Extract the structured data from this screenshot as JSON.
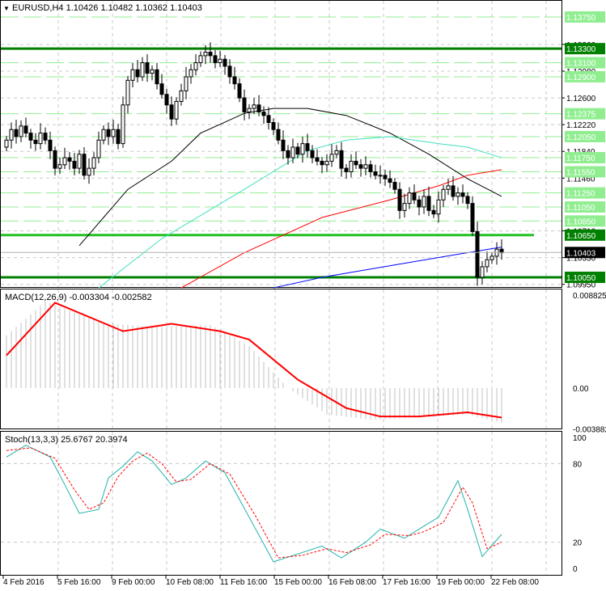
{
  "header": {
    "symbol": "EURUSD,H4",
    "ohlc": "1.10426 1.10482 1.10362 1.10403"
  },
  "macd_label": "MACD(12,26,9) -0.003304 -0.002582",
  "stoch_label": "Stoch(13,3,3) 25.6767 20.3974",
  "colors": {
    "up": "#ffffff",
    "down": "#000000",
    "level": "#008000",
    "level_light": "#90ee90",
    "ma_fast": "#000000",
    "ma_mid": "#40e0c0",
    "ma_slow": "#ff0000",
    "ma_long": "#0000ff",
    "macd": "#ff0000",
    "stoch_main": "#20b2aa",
    "stoch_signal": "#ff0000"
  },
  "chart_data": {
    "type": "candlestick",
    "symbol": "EURUSD",
    "timeframe": "H4",
    "price_range": [
      1.099,
      1.14
    ],
    "x_labels": [
      "4 Feb 2016",
      "5 Feb 16:00",
      "9 Feb 00:00",
      "10 Feb 08:00",
      "11 Feb 16:00",
      "15 Feb 00:00",
      "16 Feb 08:00",
      "17 Feb 16:00",
      "19 Feb 00:00",
      "22 Feb 08:00"
    ],
    "price_grid": [
      "1.13360",
      "1.12980",
      "1.12600",
      "1.12220",
      "1.11840",
      "1.11460",
      "1.10710",
      "1.10330",
      "1.09950"
    ],
    "levels_strong": [
      "1.13300",
      "1.10650",
      "1.10050"
    ],
    "levels_light": [
      "1.13750",
      "1.13100",
      "1.12900",
      "1.12375",
      "1.12050",
      "1.11750",
      "1.11550",
      "1.11250",
      "1.11050",
      "1.10850"
    ],
    "current_price": "1.10403",
    "closes": [
      1.12,
      1.1215,
      1.1205,
      1.122,
      1.121,
      1.12,
      1.1195,
      1.121,
      1.12,
      1.1185,
      1.116,
      1.1165,
      1.1175,
      1.117,
      1.116,
      1.118,
      1.115,
      1.116,
      1.1175,
      1.12,
      1.1215,
      1.1205,
      1.1215,
      1.1195,
      1.125,
      1.1285,
      1.13,
      1.129,
      1.131,
      1.1295,
      1.13,
      1.128,
      1.1265,
      1.125,
      1.123,
      1.1255,
      1.127,
      1.129,
      1.13,
      1.131,
      1.132,
      1.1325,
      1.132,
      1.131,
      1.1315,
      1.1305,
      1.129,
      1.128,
      1.126,
      1.124,
      1.1245,
      1.125,
      1.124,
      1.1235,
      1.1225,
      1.1215,
      1.12,
      1.1185,
      1.1175,
      1.119,
      1.118,
      1.1195,
      1.1185,
      1.1175,
      1.117,
      1.1165,
      1.117,
      1.118,
      1.1185,
      1.116,
      1.1155,
      1.117,
      1.1165,
      1.116,
      1.1165,
      1.1155,
      1.115,
      1.115,
      1.1145,
      1.114,
      1.113,
      1.11,
      1.111,
      1.1125,
      1.1115,
      1.1105,
      1.112,
      1.11,
      1.1095,
      1.1115,
      1.113,
      1.1135,
      1.112,
      1.1125,
      1.112,
      1.111,
      1.107,
      1.1005,
      1.102,
      1.103,
      1.1035,
      1.1045,
      1.104
    ],
    "first_open": 1.119,
    "moving_averages": [
      {
        "color_key": "ma_fast",
        "points": [
          [
            15,
            1.105
          ],
          [
            25,
            1.113
          ],
          [
            34,
            1.117
          ],
          [
            40,
            1.121
          ],
          [
            49,
            1.1238
          ],
          [
            55,
            1.1245
          ],
          [
            62,
            1.1245
          ],
          [
            70,
            1.1235
          ],
          [
            79,
            1.121
          ],
          [
            87,
            1.118
          ],
          [
            95,
            1.1145
          ],
          [
            102,
            1.112
          ]
        ]
      },
      {
        "color_key": "ma_mid",
        "points": [
          [
            19,
            1.099
          ],
          [
            32,
            1.106
          ],
          [
            49,
            1.113
          ],
          [
            62,
            1.1185
          ],
          [
            70,
            1.12
          ],
          [
            79,
            1.1205
          ],
          [
            89,
            1.1195
          ],
          [
            95,
            1.119
          ],
          [
            102,
            1.1175
          ]
        ]
      },
      {
        "color_key": "ma_slow",
        "points": [
          [
            36,
            1.099
          ],
          [
            49,
            1.104
          ],
          [
            65,
            1.109
          ],
          [
            79,
            1.1115
          ],
          [
            89,
            1.1135
          ],
          [
            95,
            1.115
          ],
          [
            102,
            1.1158
          ]
        ]
      },
      {
        "color_key": "ma_long",
        "points": [
          [
            55,
            1.099
          ],
          [
            65,
            1.1005
          ],
          [
            82,
            1.1025
          ],
          [
            95,
            1.104
          ],
          [
            102,
            1.1048
          ]
        ]
      }
    ],
    "macd": {
      "range": [
        -0.003882,
        0.008825
      ],
      "ticks": [
        "0.008825",
        "0.00",
        "-0.003882"
      ],
      "signal": [
        [
          0,
          0.0031
        ],
        [
          10,
          0.0081
        ],
        [
          24,
          0.0054
        ],
        [
          34,
          0.0061
        ],
        [
          44,
          0.0054
        ],
        [
          50,
          0.0046
        ],
        [
          60,
          0.0008
        ],
        [
          70,
          -0.0019
        ],
        [
          77,
          -0.0027
        ],
        [
          85,
          -0.0027
        ],
        [
          95,
          -0.0023
        ],
        [
          102,
          -0.0028
        ]
      ],
      "histogram": [
        [
          0,
          0.005
        ],
        [
          8,
          0.0082
        ],
        [
          20,
          0.0062
        ],
        [
          30,
          0.0058
        ],
        [
          42,
          0.006
        ],
        [
          50,
          0.004
        ],
        [
          58,
          0.0
        ],
        [
          66,
          -0.0025
        ],
        [
          75,
          -0.003
        ],
        [
          85,
          -0.0028
        ],
        [
          95,
          -0.0025
        ],
        [
          102,
          -0.0033
        ]
      ]
    },
    "stoch": {
      "range": [
        0,
        100
      ],
      "ticks": [
        "100",
        "80",
        "20",
        "0"
      ],
      "main": [
        [
          0,
          85
        ],
        [
          4,
          94
        ],
        [
          9,
          85
        ],
        [
          12,
          64
        ],
        [
          15,
          42
        ],
        [
          19,
          45
        ],
        [
          21,
          69
        ],
        [
          24,
          78
        ],
        [
          27,
          89
        ],
        [
          30,
          82
        ],
        [
          34,
          64
        ],
        [
          37,
          69
        ],
        [
          41,
          82
        ],
        [
          45,
          73
        ],
        [
          50,
          39
        ],
        [
          55,
          5
        ],
        [
          60,
          11
        ],
        [
          65,
          17
        ],
        [
          69,
          8
        ],
        [
          74,
          20
        ],
        [
          77,
          30
        ],
        [
          82,
          23
        ],
        [
          85,
          30
        ],
        [
          89,
          39
        ],
        [
          93,
          67
        ],
        [
          95,
          45
        ],
        [
          98,
          9
        ],
        [
          102,
          26
        ]
      ],
      "signal": [
        [
          0,
          90
        ],
        [
          5,
          92
        ],
        [
          10,
          84
        ],
        [
          14,
          60
        ],
        [
          17,
          45
        ],
        [
          20,
          50
        ],
        [
          23,
          70
        ],
        [
          26,
          82
        ],
        [
          29,
          88
        ],
        [
          32,
          80
        ],
        [
          35,
          66
        ],
        [
          38,
          68
        ],
        [
          42,
          80
        ],
        [
          46,
          72
        ],
        [
          51,
          42
        ],
        [
          56,
          8
        ],
        [
          61,
          10
        ],
        [
          66,
          15
        ],
        [
          70,
          12
        ],
        [
          75,
          18
        ],
        [
          78,
          26
        ],
        [
          83,
          25
        ],
        [
          86,
          28
        ],
        [
          90,
          35
        ],
        [
          94,
          62
        ],
        [
          96,
          50
        ],
        [
          99,
          15
        ],
        [
          102,
          20
        ]
      ]
    }
  }
}
